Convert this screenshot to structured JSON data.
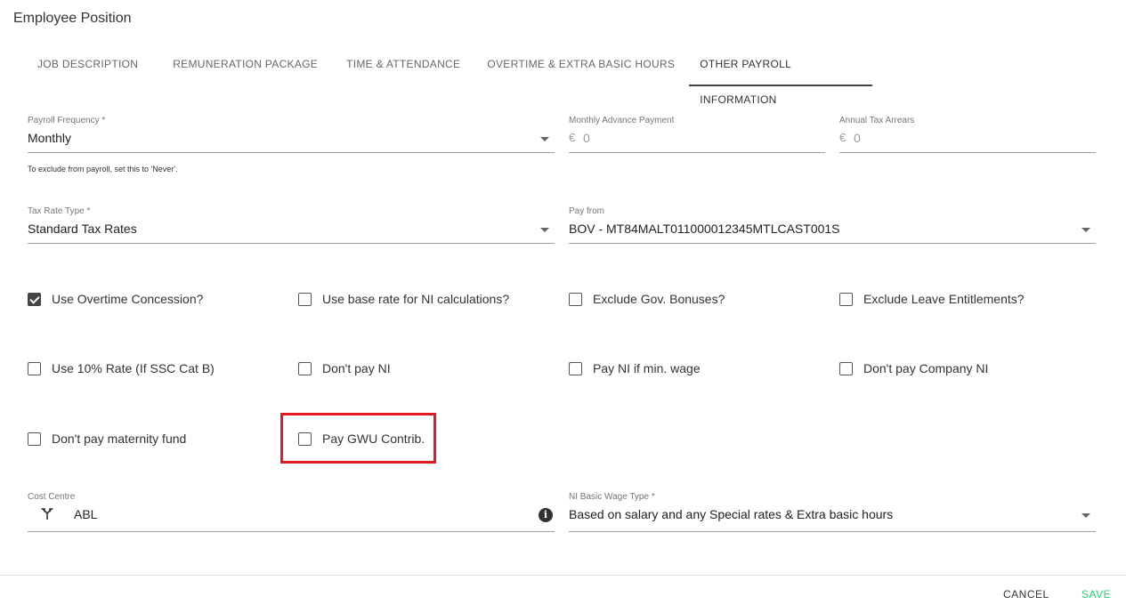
{
  "page": {
    "title": "Employee Position"
  },
  "tabs": [
    {
      "label": "JOB DESCRIPTION"
    },
    {
      "label": "REMUNERATION PACKAGE"
    },
    {
      "label": "TIME & ATTENDANCE"
    },
    {
      "label": "OVERTIME & EXTRA BASIC HOURS"
    },
    {
      "label": "OTHER PAYROLL INFORMATION"
    }
  ],
  "active_tab": "OTHER PAYROLL INFORMATION",
  "fields": {
    "payroll_frequency": {
      "label": "Payroll Frequency *",
      "value": "Monthly",
      "hint": "To exclude from payroll, set this to 'Never'."
    },
    "monthly_advance": {
      "label": "Monthly Advance Payment",
      "currency": "€",
      "value": "0"
    },
    "annual_tax_arrears": {
      "label": "Annual Tax Arrears",
      "currency": "€",
      "value": "0"
    },
    "tax_rate_type": {
      "label": "Tax Rate Type *",
      "value": "Standard Tax Rates"
    },
    "pay_from": {
      "label": "Pay from",
      "value": "BOV - MT84MALT011000012345MTLCAST001S"
    },
    "cost_centre": {
      "label": "Cost Centre",
      "value": "ABL"
    },
    "ni_basic_wage_type": {
      "label": "NI Basic Wage Type *",
      "value": "Based on salary and any Special rates & Extra basic hours"
    }
  },
  "checkboxes": {
    "use_overtime_concession": {
      "label": "Use Overtime Concession?",
      "checked": true
    },
    "use_base_rate_ni": {
      "label": "Use base rate for NI calculations?",
      "checked": false
    },
    "exclude_gov_bonuses": {
      "label": "Exclude Gov. Bonuses?",
      "checked": false
    },
    "exclude_leave_entitlements": {
      "label": "Exclude Leave Entitlements?",
      "checked": false
    },
    "use_10_rate": {
      "label": "Use 10% Rate (If SSC Cat B)",
      "checked": false
    },
    "dont_pay_ni": {
      "label": "Don't pay NI",
      "checked": false
    },
    "pay_ni_min_wage": {
      "label": "Pay NI if min. wage",
      "checked": false
    },
    "dont_pay_company_ni": {
      "label": "Don't pay Company NI",
      "checked": false
    },
    "dont_pay_maternity_fund": {
      "label": "Don't pay maternity fund",
      "checked": false
    },
    "pay_gwu_contrib": {
      "label": "Pay GWU Contrib.",
      "checked": false
    }
  },
  "footer": {
    "cancel_label": "CANCEL",
    "save_label": "SAVE"
  },
  "colors": {
    "save": "#2ecc71",
    "highlight": "#e01b24",
    "checked": "#444444"
  },
  "icons": {
    "cost_centre": "fork-icon",
    "info": "info-icon",
    "dropdown": "caret-down-icon"
  }
}
